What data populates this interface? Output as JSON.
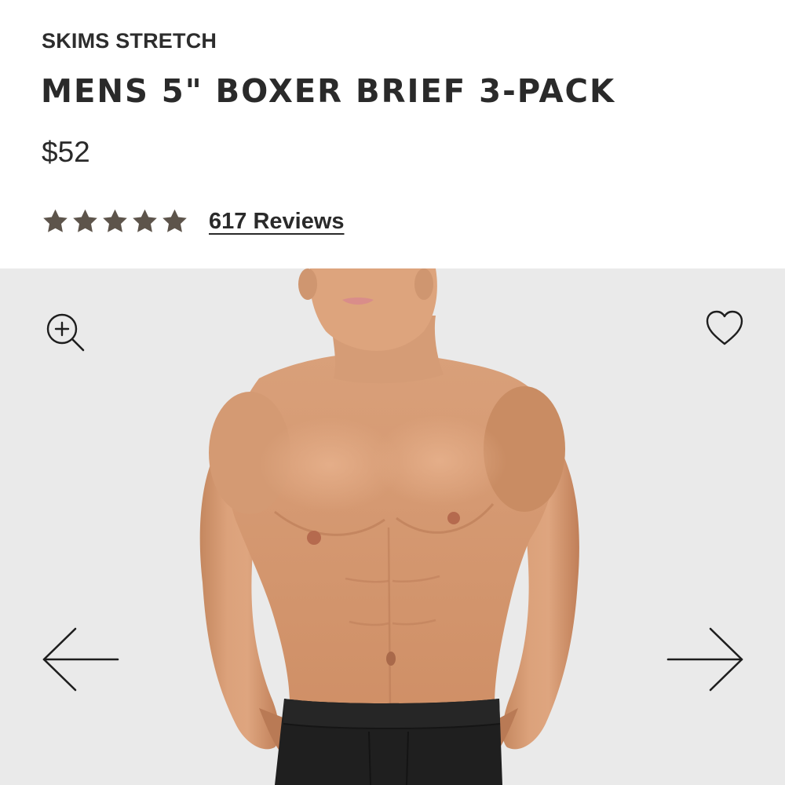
{
  "product": {
    "collection": "SKIMS STRETCH",
    "title": "MENS 5\" BOXER BRIEF 3-PACK",
    "price": "$52",
    "rating": {
      "stars": 5,
      "max_stars": 5,
      "reviews_label": "617 Reviews"
    }
  },
  "gallery": {
    "image_description": "Model wearing black boxer briefs",
    "icons": {
      "zoom": "zoom-in-icon",
      "favorite": "heart-icon",
      "previous": "arrow-left-icon",
      "next": "arrow-right-icon"
    }
  },
  "colors": {
    "text": "#2a2a2a",
    "star": "#5d544b",
    "gallery_background": "#eaeaea",
    "garment": "#1f1f1f"
  }
}
